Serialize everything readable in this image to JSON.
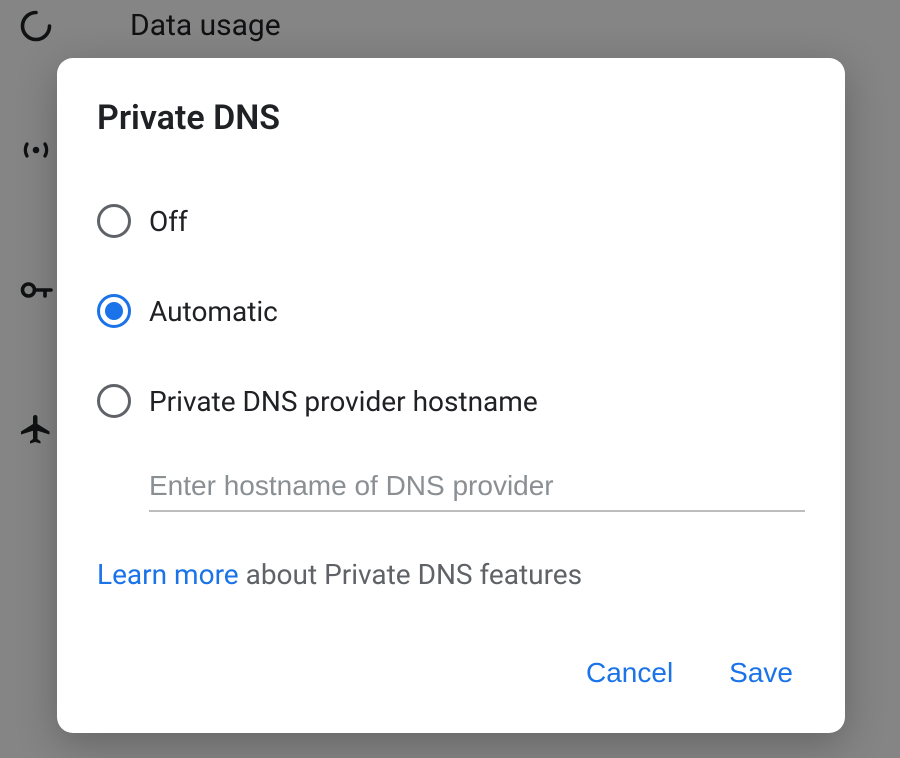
{
  "background": {
    "items": [
      {
        "label": "Data usage"
      },
      {
        "label": ""
      },
      {
        "label": ""
      },
      {
        "label": ""
      }
    ]
  },
  "dialog": {
    "title": "Private DNS",
    "options": [
      {
        "label": "Off",
        "selected": false
      },
      {
        "label": "Automatic",
        "selected": true
      },
      {
        "label": "Private DNS provider hostname",
        "selected": false
      }
    ],
    "hostname_value": "",
    "hostname_placeholder": "Enter hostname of DNS provider",
    "learn_more_link": "Learn more",
    "learn_more_rest": " about Private DNS features",
    "cancel_label": "Cancel",
    "save_label": "Save"
  }
}
